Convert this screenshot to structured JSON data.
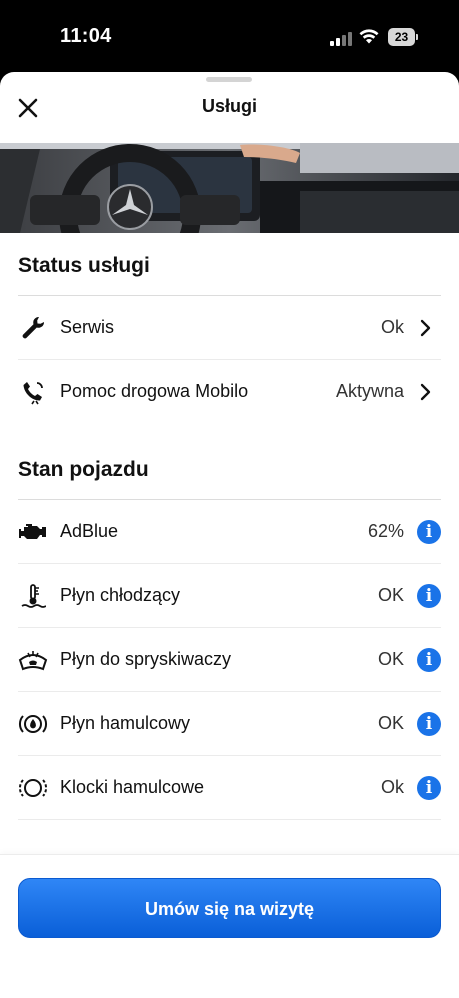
{
  "status_bar": {
    "time": "11:04",
    "battery": "23"
  },
  "header": {
    "title": "Usługi"
  },
  "service_status": {
    "title": "Status usługi",
    "items": [
      {
        "label": "Serwis",
        "value": "Ok",
        "icon": "wrench-icon"
      },
      {
        "label": "Pomoc drogowa Mobilo",
        "value": "Aktywna",
        "icon": "phone-assist-icon"
      }
    ]
  },
  "vehicle_status": {
    "title": "Stan pojazdu",
    "items": [
      {
        "label": "AdBlue",
        "value": "62%",
        "icon": "engine-icon"
      },
      {
        "label": "Płyn chłodzący",
        "value": "OK",
        "icon": "coolant-icon"
      },
      {
        "label": "Płyn do spryskiwaczy",
        "value": "OK",
        "icon": "washer-fluid-icon"
      },
      {
        "label": "Płyn hamulcowy",
        "value": "OK",
        "icon": "brake-fluid-icon"
      },
      {
        "label": "Klocki hamulcowe",
        "value": "Ok",
        "icon": "brake-pads-icon"
      }
    ]
  },
  "cta": {
    "label": "Umów się na wizytę"
  },
  "colors": {
    "accent": "#1a73e8",
    "button": "#1469e0",
    "text": "#111111"
  }
}
